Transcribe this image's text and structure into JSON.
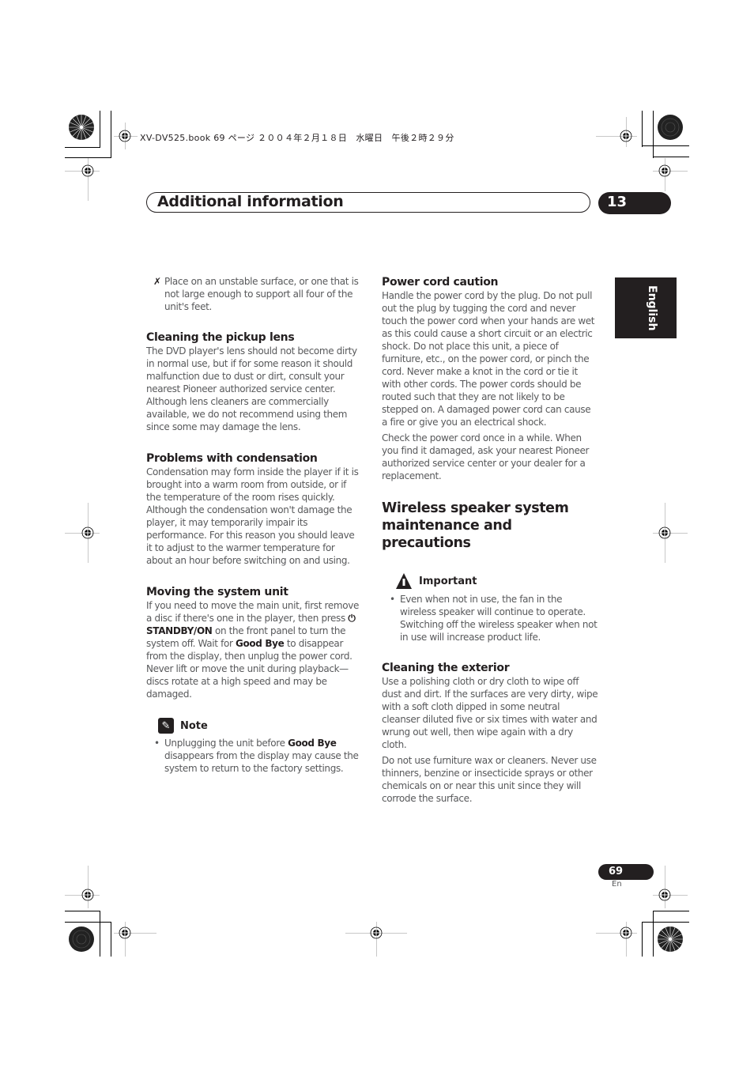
{
  "book_meta": "XV-DV525.book  69 ページ  ２００４年２月１８日　水曜日　午後２時２９分",
  "header": {
    "title": "Additional information",
    "chapter": "13"
  },
  "language_tab": "English",
  "left_column": {
    "carryover_bullet": {
      "icon": "cross-mark-icon",
      "glyph": "✗",
      "text": "Place on an unstable surface, or one that is not large enough to support all four of the unit's feet."
    },
    "sections": [
      {
        "heading": "Cleaning the pickup lens",
        "body": "The DVD player's lens should not become dirty in normal use, but if for some reason it should malfunction due to dust or dirt, consult your nearest Pioneer authorized service center. Although lens cleaners are commercially available, we do not recommend using them since some may damage the lens."
      },
      {
        "heading": "Problems with condensation",
        "body": "Condensation may form inside the player if it is brought into a warm room from outside, or if the temperature of the room rises quickly. Although the condensation won't damage the player, it may temporarily impair its performance. For this reason you should leave it to adjust to the warmer temperature for about an hour before switching on and using."
      },
      {
        "heading": "Moving the system unit",
        "body_parts": {
          "p1": "If you need to move the main unit, first remove a disc if there's one in the player, then press ",
          "power_glyph": "⏻",
          "standby": "STANDBY/ON",
          "p2": " on the front panel to turn the system off. Wait for ",
          "goodbye": "Good Bye",
          "p3": " to disappear from the display, then unplug the power cord. Never lift or move the unit during playback—discs rotate at a high speed and may be damaged."
        }
      }
    ],
    "note": {
      "label": "Note",
      "icon": "pencil-icon",
      "bullet": {
        "p1": "Unplugging the unit before ",
        "bold": "Good Bye",
        "p2": " disappears from the display may cause the system to return to the factory settings."
      }
    }
  },
  "right_column": {
    "power_cord": {
      "heading": "Power cord caution",
      "body1": "Handle the power cord by the plug. Do not pull out the plug by tugging the cord and never touch the power cord when your hands are wet as this could cause a short circuit or an electric shock. Do not place this unit, a piece of furniture, etc., on the power cord, or pinch the cord. Never make a knot in the cord or tie it with other cords. The power cords should be routed such that they are not likely to be stepped on. A damaged power cord can cause a fire or give you an electrical shock.",
      "body2": "Check the power cord once in a while. When you find it damaged, ask your nearest Pioneer authorized service center or your dealer for a replacement."
    },
    "wireless": {
      "heading": "Wireless speaker system maintenance and precautions",
      "important": {
        "label": "Important",
        "icon": "warning-hand-icon",
        "bullet": "Even when not in use, the fan in the wireless speaker will continue to operate. Switching off the wireless speaker when not in use will increase product life."
      }
    },
    "exterior": {
      "heading": "Cleaning the exterior",
      "body1": "Use a polishing cloth or dry cloth to wipe off dust and dirt. If the surfaces are very dirty, wipe with a soft cloth dipped in some neutral cleanser diluted five or six times with water and wrung out well, then wipe again with a dry cloth.",
      "body2": "Do not use furniture wax or cleaners. Never use thinners, benzine or insecticide sprays or other chemicals on or near this unit since they will corrode the surface."
    }
  },
  "footer": {
    "page_number": "69",
    "language_code": "En"
  }
}
